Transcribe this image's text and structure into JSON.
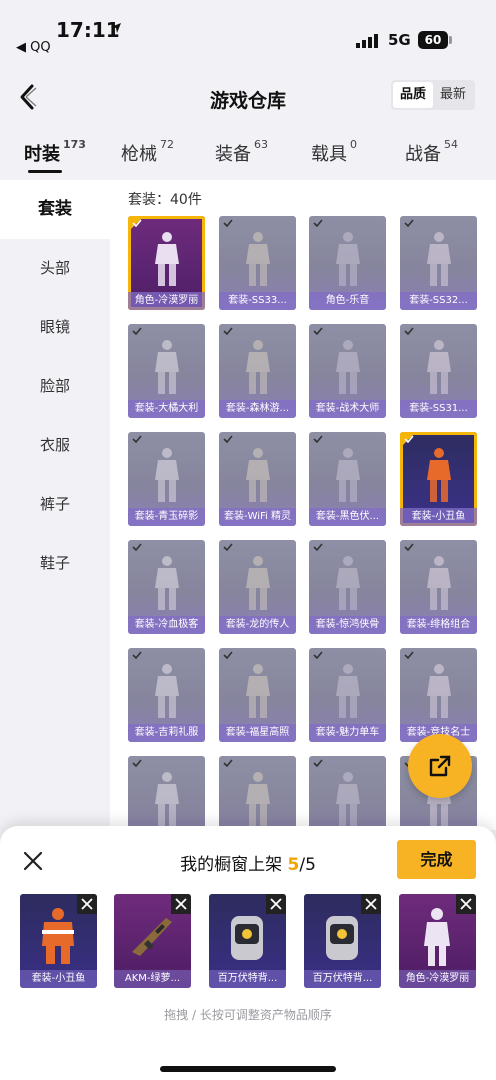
{
  "status_bar": {
    "time": "17:11",
    "back_app": "◀ QQ",
    "network": "5G",
    "battery": "60"
  },
  "header": {
    "title": "游戏仓库",
    "sort_options": [
      "品质",
      "最新"
    ],
    "active_sort": "品质"
  },
  "tabs": [
    {
      "label": "时装",
      "count": "173",
      "active": true
    },
    {
      "label": "枪械",
      "count": "72"
    },
    {
      "label": "装备",
      "count": "63"
    },
    {
      "label": "载具",
      "count": "0"
    },
    {
      "label": "战备",
      "count": "54"
    }
  ],
  "sidebar": [
    {
      "label": "套装",
      "active": true
    },
    {
      "label": "头部"
    },
    {
      "label": "眼镜"
    },
    {
      "label": "脸部"
    },
    {
      "label": "衣服"
    },
    {
      "label": "裤子"
    },
    {
      "label": "鞋子"
    }
  ],
  "grid": {
    "count_label": "套装：40件",
    "items": [
      {
        "label": "角色-冷漠罗丽",
        "style": "purple",
        "selected": true
      },
      {
        "label": "套装-SS33...",
        "style": "grey"
      },
      {
        "label": "角色-乐音",
        "style": "grey"
      },
      {
        "label": "套装-SS32...",
        "style": "grey"
      },
      {
        "label": "套装-大橘大利",
        "style": "grey"
      },
      {
        "label": "套装-森林游...",
        "style": "grey"
      },
      {
        "label": "套装-战术大师",
        "style": "grey"
      },
      {
        "label": "套装-SS31...",
        "style": "grey"
      },
      {
        "label": "套装-青玉碎影",
        "style": "grey"
      },
      {
        "label": "套装-WiFi 精灵",
        "style": "grey"
      },
      {
        "label": "套装-黑色伏...",
        "style": "grey"
      },
      {
        "label": "套装-小丑鱼",
        "style": "blue",
        "selected": true
      },
      {
        "label": "套装-冷血极客",
        "style": "grey"
      },
      {
        "label": "套装-龙的传人",
        "style": "grey"
      },
      {
        "label": "套装-惊鸿侠骨",
        "style": "grey"
      },
      {
        "label": "套装-绯格组合",
        "style": "grey"
      },
      {
        "label": "套装-吉莉礼服",
        "style": "grey"
      },
      {
        "label": "套装-福星高照",
        "style": "grey"
      },
      {
        "label": "套装-魅力单车",
        "style": "grey"
      },
      {
        "label": "套装-竞技名士",
        "style": "grey"
      },
      {
        "label": "",
        "style": "grey"
      },
      {
        "label": "",
        "style": "grey"
      },
      {
        "label": "",
        "style": "grey"
      },
      {
        "label": "",
        "style": "grey"
      }
    ]
  },
  "showcase": {
    "title": "我的橱窗上架",
    "filled": "5",
    "total": "/5",
    "done_label": "完成",
    "hint": "拖拽 / 长按可调整资产物品顺序",
    "slots": [
      {
        "label": "套装-小丑鱼",
        "style": "b",
        "icon": "clownfish-suit-icon"
      },
      {
        "label": "AKM-绿萝...",
        "style": "p",
        "icon": "rifle-icon"
      },
      {
        "label": "百万伏特背...",
        "style": "b",
        "icon": "backpack-icon"
      },
      {
        "label": "百万伏特背...",
        "style": "b",
        "icon": "backpack-icon"
      },
      {
        "label": "角色-冷漠罗丽",
        "style": "p",
        "icon": "character-icon"
      }
    ]
  },
  "colors": {
    "accent": "#f7b324",
    "card_grey": "#8e8fa4",
    "card_purple": "#5a2470",
    "card_blue": "#36307a"
  }
}
